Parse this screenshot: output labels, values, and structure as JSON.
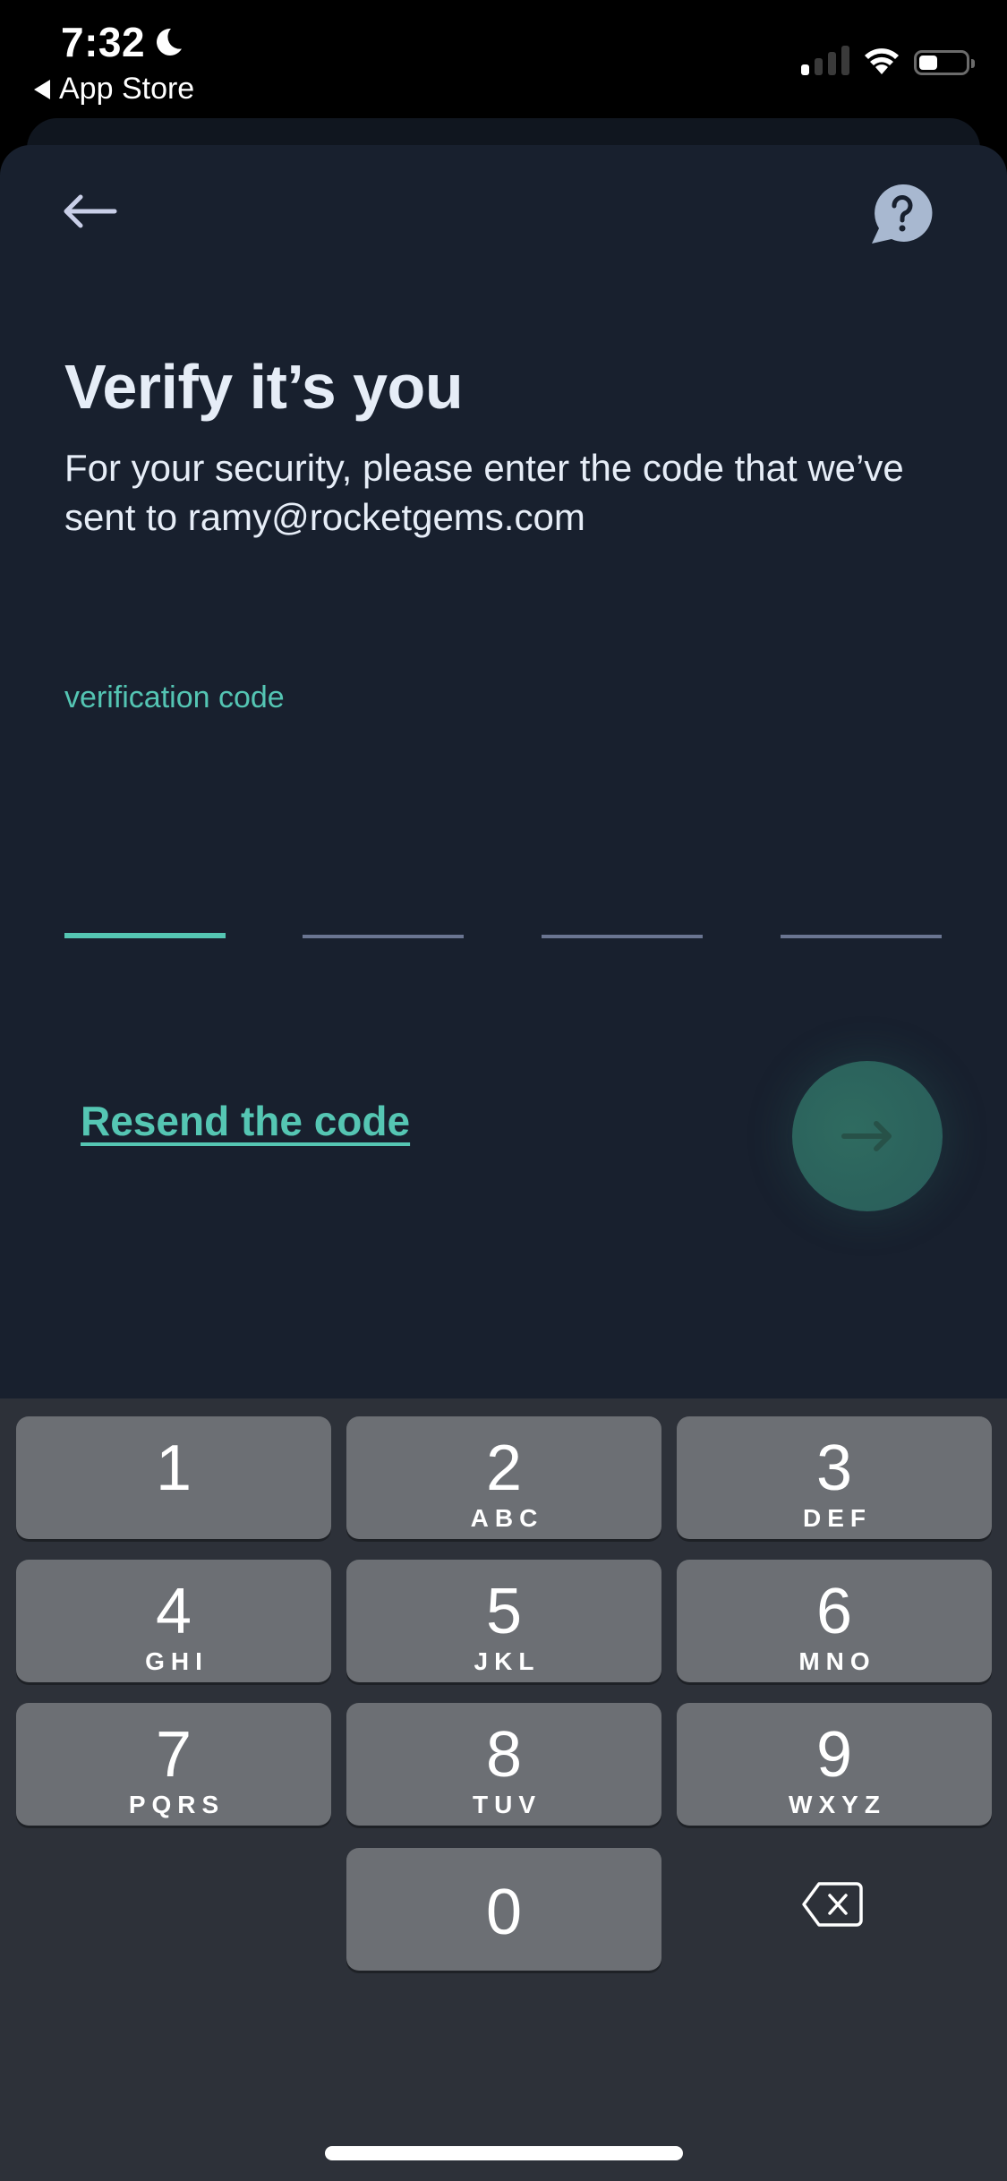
{
  "status_bar": {
    "time": "7:32",
    "focus_icon": "moon-icon",
    "back_app_label": "App Store",
    "signal_bars_active": 1,
    "signal_bars_total": 4,
    "wifi_icon": "wifi-icon",
    "battery_level_percent": 40
  },
  "header": {
    "back_icon": "arrow-left-icon",
    "help_icon": "help-chat-bubble-icon"
  },
  "main": {
    "title": "Verify it’s you",
    "subtitle": "For your security, please enter the code that we’ve sent to ramy@rocketgems.com",
    "code_label": "verification code",
    "code_length": 4,
    "code_value": "",
    "active_slot_index": 0,
    "resend_label": "Resend the code",
    "submit_icon": "arrow-right-icon",
    "submit_enabled": false
  },
  "keyboard": {
    "keys": [
      {
        "num": "1",
        "letters": ""
      },
      {
        "num": "2",
        "letters": "ABC"
      },
      {
        "num": "3",
        "letters": "DEF"
      },
      {
        "num": "4",
        "letters": "GHI"
      },
      {
        "num": "5",
        "letters": "JKL"
      },
      {
        "num": "6",
        "letters": "MNO"
      },
      {
        "num": "7",
        "letters": "PQRS"
      },
      {
        "num": "8",
        "letters": "TUV"
      },
      {
        "num": "9",
        "letters": "WXYZ"
      },
      {
        "num": "0",
        "letters": ""
      }
    ],
    "delete_icon": "backspace-icon"
  },
  "colors": {
    "accent": "#55c6b3",
    "background": "#18202e",
    "title": "#e6edf7",
    "inactive_slot": "#6a7591",
    "keyboard_bg": "#2d3139",
    "key_bg": "#6c6f74",
    "submit_bg": "#2d665e"
  }
}
